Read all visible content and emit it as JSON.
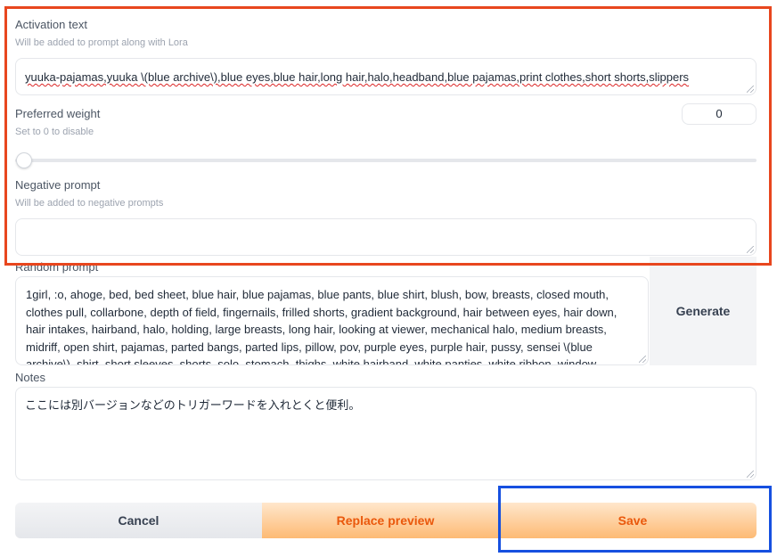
{
  "activation": {
    "label": "Activation text",
    "hint": "Will be added to prompt along with Lora",
    "value": "yuuka-pajamas,yuuka \\(blue archive\\),blue eyes,blue hair,long hair,halo,headband,blue pajamas,print clothes,short shorts,slippers"
  },
  "weight": {
    "label": "Preferred weight",
    "hint": "Set to 0 to disable",
    "value": "0",
    "slider_level": 0
  },
  "negative": {
    "label": "Negative prompt",
    "hint": "Will be added to negative prompts",
    "value": ""
  },
  "random": {
    "label": "Random prompt",
    "value": "1girl, :o, ahoge, bed, bed sheet, blue hair, blue pajamas, blue pants, blue shirt, blush, bow, breasts, closed mouth, clothes pull, collarbone, depth of field, fingernails, frilled shorts, gradient background, hair between eyes, hair down, hair intakes, hairband, halo, holding, large breasts, long hair, looking at viewer, mechanical halo, medium breasts, midriff, open shirt, pajamas, parted bangs, parted lips, pillow, pov, purple eyes, purple hair, pussy, sensei \\(blue archive\\), shirt, short sleeves, shorts, solo, stomach, thighs, white hairband, white panties, white ribbon, window",
    "generate_label": "Generate"
  },
  "notes": {
    "label": "Notes",
    "value": "ここには別バージョンなどのトリガーワードを入れとくと便利。"
  },
  "buttons": {
    "cancel": "Cancel",
    "replace": "Replace preview",
    "save": "Save"
  },
  "colors": {
    "highlight_red": "#e8461e",
    "highlight_blue": "#1650e0",
    "primary_text": "#ea580c",
    "primary_bg_start": "#fed7aa",
    "primary_bg_end": "#fdba74"
  }
}
